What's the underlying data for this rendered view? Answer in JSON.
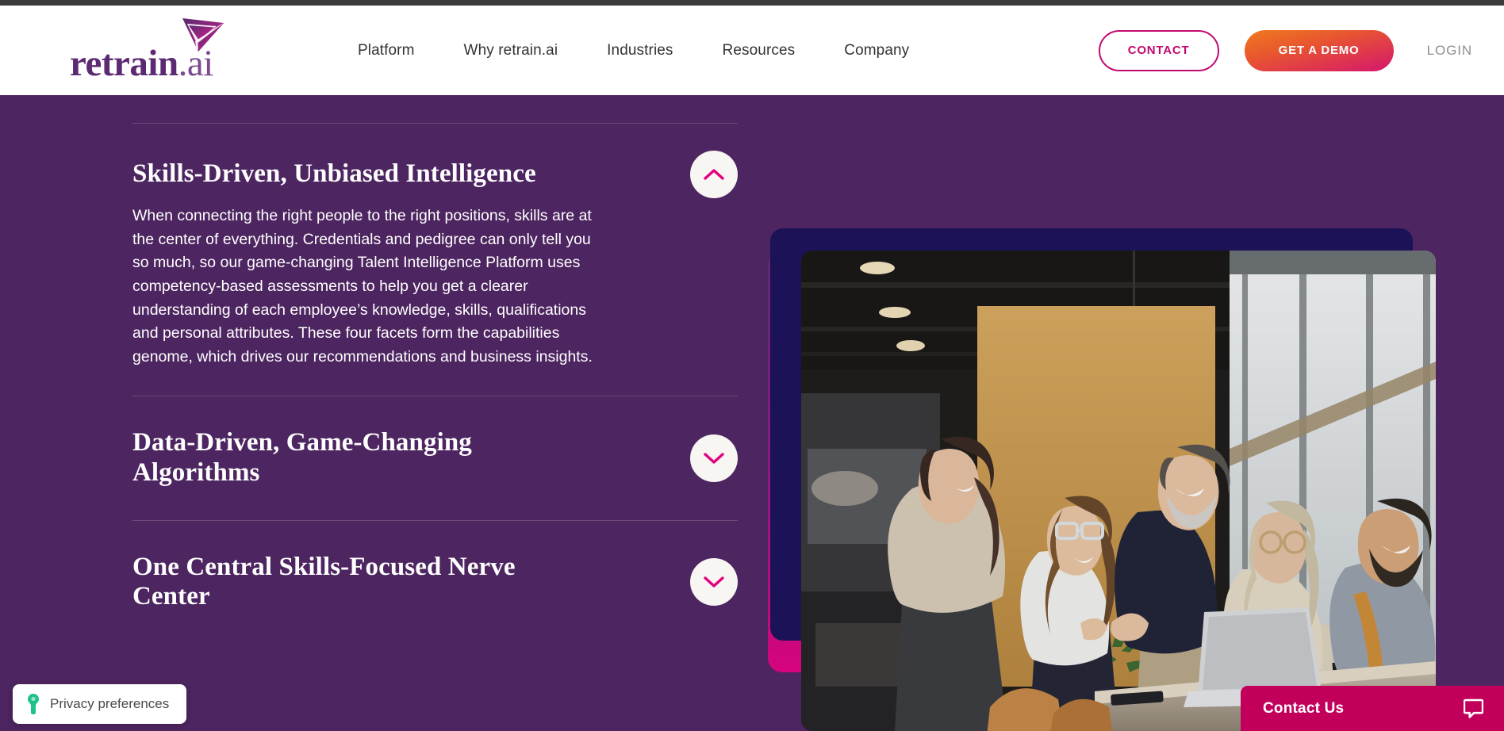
{
  "header": {
    "logo": {
      "brand": "retrain",
      "suffix": ".ai",
      "mark": "paper-plane-logo-icon"
    },
    "nav": [
      {
        "label": "Platform"
      },
      {
        "label": "Why retrain.ai"
      },
      {
        "label": "Industries"
      },
      {
        "label": "Resources"
      },
      {
        "label": "Company"
      }
    ],
    "contact_label": "CONTACT",
    "demo_label": "GET A DEMO",
    "login_label": "LOGIN",
    "colors": {
      "accent_pink": "#c2096e",
      "demo_gradient_start": "#ef7a1e",
      "demo_gradient_end": "#d5166d"
    }
  },
  "main": {
    "background_color": "#4d2560",
    "accordion": [
      {
        "title": "Skills-Driven, Unbiased Intelligence",
        "expanded": true,
        "toggle_icon": "chevron-up-icon",
        "body": "When connecting the right people to the right positions, skills are at the center of everything. Credentials and pedigree can only tell you so much, so our game-changing Talent Intelligence Platform uses competency-based assessments to help you get a clearer understanding of each employee’s knowledge, skills, qualifications and personal attributes. These four facets form the capabilities genome, which drives our recommendations and business insights."
      },
      {
        "title": "Data-Driven, Game-Changing Algorithms",
        "expanded": false,
        "toggle_icon": "chevron-down-icon",
        "body": ""
      },
      {
        "title": "One Central Skills-Focused Nerve Center",
        "expanded": false,
        "toggle_icon": "chevron-down-icon",
        "body": ""
      }
    ],
    "image": {
      "alt": "Five colleagues laughing together around a laptop in a bright modern office",
      "back_layer_gradient_start": "#5e2a72",
      "back_layer_gradient_end": "#e4007e",
      "mid_layer_color": "#1c1258"
    }
  },
  "widgets": {
    "privacy": {
      "label": "Privacy preferences",
      "icon": "fingerprint-icon",
      "icon_color": "#1fc28a"
    },
    "chat": {
      "label": "Contact Us",
      "icon": "chat-bubble-icon",
      "background": "#c2005c"
    }
  }
}
